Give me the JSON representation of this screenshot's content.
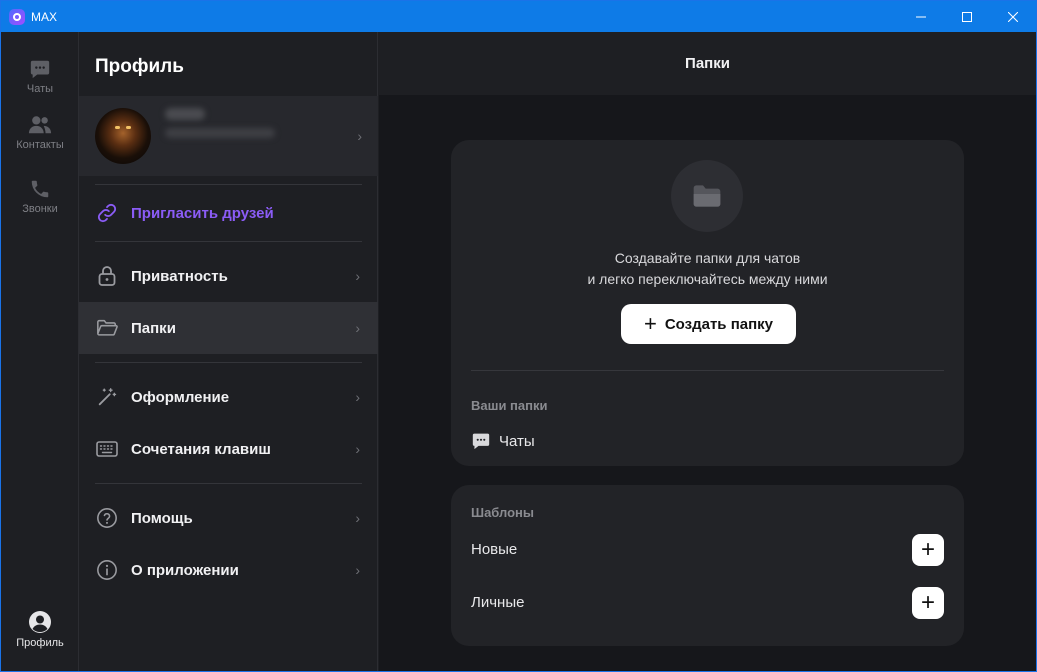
{
  "window": {
    "title": "MAX"
  },
  "rail": {
    "chats": "Чаты",
    "contacts": "Контакты",
    "calls": "Звонки",
    "profile": "Профиль"
  },
  "panel": {
    "title": "Профиль",
    "invite": "Пригласить друзей",
    "items": [
      {
        "label": "Приватность"
      },
      {
        "label": "Папки"
      },
      {
        "label": "Оформление"
      },
      {
        "label": "Сочетания клавиш"
      },
      {
        "label": "Помощь"
      },
      {
        "label": "О приложении"
      }
    ]
  },
  "content": {
    "header": "Папки",
    "promo_line1": "Создавайте папки для чатов",
    "promo_line2": "и легко переключайтесь между ними",
    "create_button": "Создать папку",
    "your_folders_title": "Ваши папки",
    "folders": [
      {
        "name": "Чаты"
      }
    ],
    "templates_title": "Шаблоны",
    "templates": [
      {
        "name": "Новые"
      },
      {
        "name": "Личные"
      }
    ]
  },
  "colors": {
    "accent": "#8b5cf6",
    "titlebar": "#0e7be7",
    "background": "#1e1f23"
  }
}
